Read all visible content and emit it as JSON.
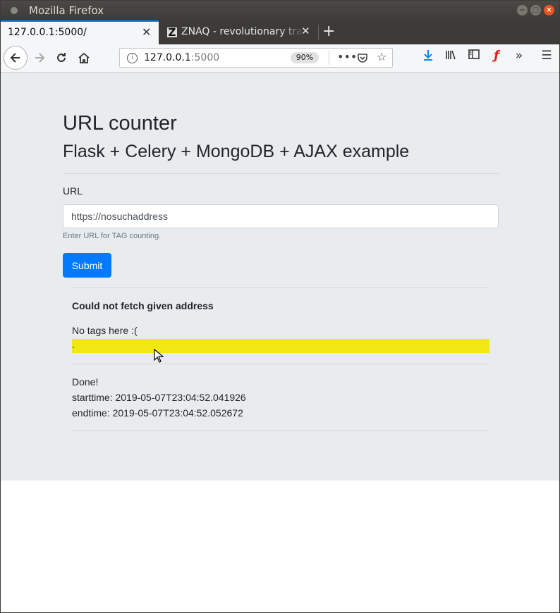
{
  "window": {
    "title": "Mozilla Firefox",
    "buttons": {
      "minimize": "−",
      "maximize": "□",
      "close": "×"
    }
  },
  "tabs": [
    {
      "label": "127.0.0.1:5000/",
      "active": true
    },
    {
      "label": "ZNAQ - revolutionary tra",
      "favicon": "Z",
      "active": false
    }
  ],
  "toolbar": {
    "url_host": "127.0.0.1",
    "url_port": ":5000",
    "zoom": "90%",
    "icons": [
      "back-icon",
      "forward-icon",
      "reload-icon",
      "home-icon",
      "info-icon",
      "page-actions-icon",
      "pocket-icon",
      "bookmark-star-icon",
      "download-icon",
      "library-icon",
      "sidebar-icon",
      "flash-icon",
      "overflow-icon",
      "menu-icon"
    ]
  },
  "page": {
    "title": "URL counter",
    "subtitle": "Flask + Celery + MongoDB + AJAX example",
    "form": {
      "label": "URL",
      "input_value": "https://nosuchaddress",
      "help": "Enter URL for TAG counting.",
      "submit_label": "Submit"
    },
    "result": {
      "error_title": "Could not fetch given address",
      "tags_text": "No tags here :(",
      "highlight_text": ".",
      "highlight_color": "#f1e713",
      "status": "Done!",
      "starttime": "starttime: 2019-05-07T23:04:52.041926",
      "endtime": "endtime: 2019-05-07T23:04:52.052672"
    }
  },
  "colors": {
    "accent": "#007bff",
    "page_bg": "#e9ecef",
    "titlebar_close": "#e95420"
  }
}
